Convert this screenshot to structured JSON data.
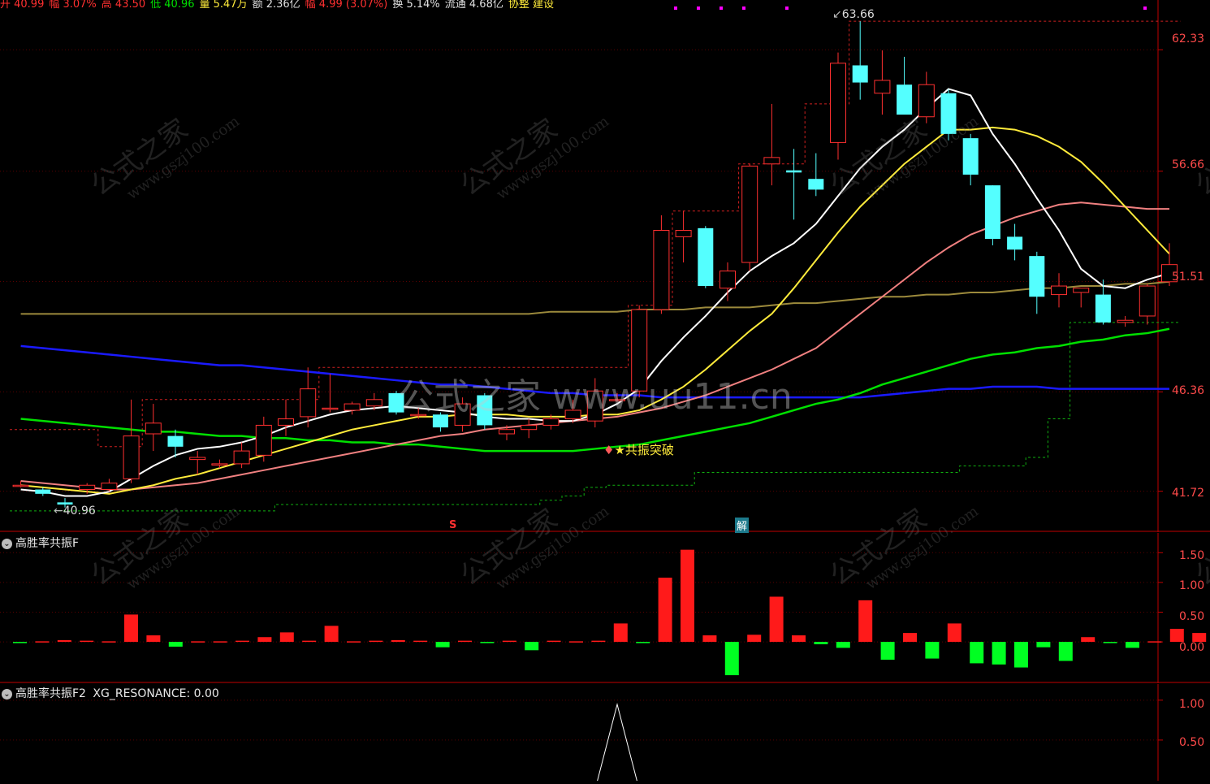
{
  "info_bar": {
    "items": [
      {
        "text": "开 40.99",
        "color": "#ff3030"
      },
      {
        "text": "幅 3.07%",
        "color": "#ff3030"
      },
      {
        "text": "高 43.50",
        "color": "#ff3030"
      },
      {
        "text": "低 40.96",
        "color": "#00e000"
      },
      {
        "text": "量 5.47万",
        "color": "#ffeb3b"
      },
      {
        "text": "额 2.36亿",
        "color": "#e0e0e0"
      },
      {
        "text": "幅 4.99 (3.07%)",
        "color": "#ff3030"
      },
      {
        "text": "换 5.14%",
        "color": "#e0e0e0"
      },
      {
        "text": "流通 4.68亿",
        "color": "#e0e0e0"
      },
      {
        "text": "协整 建设",
        "color": "#ffeb3b"
      }
    ]
  },
  "price_axis": {
    "labels": [
      "62.33",
      "56.66",
      "51.51",
      "46.36",
      "41.72"
    ]
  },
  "annotations": {
    "high_label": "63.66",
    "low_label": "40.96",
    "resonance_label": "★共振突破",
    "marker_s": "S",
    "marker_jie": "解"
  },
  "center_watermark": "公式之家  www.uu11.cn",
  "watermark_text": {
    "main": "公式之家",
    "url": "www.gszj100.com"
  },
  "osc_panel": {
    "title": "高胜率共振F",
    "axis_labels": [
      "1.50",
      "1.00",
      "0.50",
      "0.00"
    ]
  },
  "sig_panel": {
    "title": "高胜率共振F2",
    "indicator_label": "XG_RESONANCE: 0.00",
    "axis_labels": [
      "1.00",
      "0.50"
    ]
  },
  "colors": {
    "up": "#ff3030",
    "down": "#54ffff",
    "ma5": "#ffffff",
    "ma10": "#ffeb3b",
    "ma20": "#f08080",
    "ma60": "#00e000",
    "ma_long1": "#9c8a3c",
    "ma_long2": "#1a1aff",
    "axis": "#c00000"
  },
  "chart_data": {
    "type": "candlestick",
    "price_axis_range": [
      40.0,
      64.5
    ],
    "candles": [
      {
        "o": 42.0,
        "h": 42.2,
        "l": 41.9,
        "c": 42.0
      },
      {
        "o": 41.8,
        "h": 41.9,
        "l": 41.5,
        "c": 41.6
      },
      {
        "o": 41.2,
        "h": 41.4,
        "l": 40.96,
        "c": 41.1
      },
      {
        "o": 41.8,
        "h": 42.1,
        "l": 41.6,
        "c": 42.0
      },
      {
        "o": 41.8,
        "h": 42.3,
        "l": 41.7,
        "c": 42.1
      },
      {
        "o": 42.3,
        "h": 46.0,
        "l": 42.1,
        "c": 44.3
      },
      {
        "o": 44.4,
        "h": 45.8,
        "l": 43.6,
        "c": 44.9
      },
      {
        "o": 44.3,
        "h": 44.6,
        "l": 43.3,
        "c": 43.8
      },
      {
        "o": 43.2,
        "h": 43.6,
        "l": 42.5,
        "c": 43.3
      },
      {
        "o": 43.0,
        "h": 43.2,
        "l": 42.8,
        "c": 43.0
      },
      {
        "o": 43.0,
        "h": 44.0,
        "l": 42.8,
        "c": 43.6
      },
      {
        "o": 43.4,
        "h": 45.2,
        "l": 43.1,
        "c": 44.8
      },
      {
        "o": 44.8,
        "h": 46.0,
        "l": 44.3,
        "c": 45.1
      },
      {
        "o": 45.2,
        "h": 47.5,
        "l": 44.7,
        "c": 46.5
      },
      {
        "o": 45.6,
        "h": 47.2,
        "l": 45.4,
        "c": 45.6
      },
      {
        "o": 45.5,
        "h": 45.9,
        "l": 45.3,
        "c": 45.8
      },
      {
        "o": 45.7,
        "h": 46.3,
        "l": 45.5,
        "c": 46.0
      },
      {
        "o": 46.3,
        "h": 46.4,
        "l": 45.3,
        "c": 45.4
      },
      {
        "o": 45.3,
        "h": 45.6,
        "l": 45.1,
        "c": 45.3
      },
      {
        "o": 45.3,
        "h": 45.4,
        "l": 44.5,
        "c": 44.7
      },
      {
        "o": 44.8,
        "h": 46.1,
        "l": 44.5,
        "c": 45.8
      },
      {
        "o": 46.2,
        "h": 46.3,
        "l": 44.6,
        "c": 44.8
      },
      {
        "o": 44.4,
        "h": 44.8,
        "l": 44.1,
        "c": 44.6
      },
      {
        "o": 44.6,
        "h": 45.1,
        "l": 44.2,
        "c": 44.8
      },
      {
        "o": 44.8,
        "h": 45.3,
        "l": 44.6,
        "c": 45.1
      },
      {
        "o": 45.1,
        "h": 46.0,
        "l": 44.9,
        "c": 45.5
      },
      {
        "o": 45.0,
        "h": 47.0,
        "l": 44.7,
        "c": 46.4
      },
      {
        "o": 46.0,
        "h": 46.3,
        "l": 45.9,
        "c": 46.0
      },
      {
        "o": 46.4,
        "h": 50.4,
        "l": 46.1,
        "c": 50.2
      },
      {
        "o": 50.2,
        "h": 54.6,
        "l": 50.0,
        "c": 53.9
      },
      {
        "o": 53.6,
        "h": 54.8,
        "l": 52.4,
        "c": 53.9
      },
      {
        "o": 54.0,
        "h": 54.1,
        "l": 51.2,
        "c": 51.3
      },
      {
        "o": 51.2,
        "h": 52.4,
        "l": 50.6,
        "c": 52.0
      },
      {
        "o": 52.4,
        "h": 57.0,
        "l": 52.0,
        "c": 56.9
      },
      {
        "o": 57.0,
        "h": 59.8,
        "l": 56.0,
        "c": 57.3
      },
      {
        "o": 56.7,
        "h": 57.7,
        "l": 54.4,
        "c": 56.6
      },
      {
        "o": 56.3,
        "h": 57.5,
        "l": 55.5,
        "c": 55.8
      },
      {
        "o": 58.0,
        "h": 62.2,
        "l": 57.2,
        "c": 61.7
      },
      {
        "o": 61.6,
        "h": 63.66,
        "l": 60.0,
        "c": 60.8
      },
      {
        "o": 60.3,
        "h": 62.3,
        "l": 59.3,
        "c": 60.9
      },
      {
        "o": 60.7,
        "h": 62.0,
        "l": 59.4,
        "c": 59.3
      },
      {
        "o": 59.2,
        "h": 61.3,
        "l": 58.9,
        "c": 60.7
      },
      {
        "o": 60.3,
        "h": 60.5,
        "l": 58.1,
        "c": 58.4
      },
      {
        "o": 58.2,
        "h": 58.4,
        "l": 56.0,
        "c": 56.5
      },
      {
        "o": 56.0,
        "h": 56.0,
        "l": 53.2,
        "c": 53.5
      },
      {
        "o": 53.6,
        "h": 54.2,
        "l": 52.5,
        "c": 53.0
      },
      {
        "o": 52.7,
        "h": 52.9,
        "l": 50.0,
        "c": 50.8
      },
      {
        "o": 50.9,
        "h": 51.9,
        "l": 50.3,
        "c": 51.3
      },
      {
        "o": 51.0,
        "h": 51.2,
        "l": 50.3,
        "c": 51.2
      },
      {
        "o": 50.9,
        "h": 51.6,
        "l": 49.5,
        "c": 49.6
      },
      {
        "o": 49.6,
        "h": 49.9,
        "l": 49.4,
        "c": 49.7
      },
      {
        "o": 49.9,
        "h": 51.4,
        "l": 49.5,
        "c": 51.3
      },
      {
        "o": 51.5,
        "h": 53.3,
        "l": 51.3,
        "c": 52.3
      }
    ],
    "ma5": [
      41.8,
      41.7,
      41.5,
      41.5,
      41.7,
      42.3,
      42.9,
      43.4,
      43.7,
      43.8,
      44.0,
      44.3,
      44.7,
      45.0,
      45.3,
      45.5,
      45.6,
      45.7,
      45.6,
      45.5,
      45.4,
      45.2,
      45.1,
      45.1,
      45.0,
      45.0,
      45.3,
      45.8,
      46.5,
      47.8,
      48.9,
      49.9,
      51.0,
      52.0,
      52.7,
      53.3,
      54.2,
      55.5,
      56.8,
      57.8,
      58.6,
      59.6,
      60.5,
      60.2,
      58.4,
      57.0,
      55.4,
      53.9,
      52.1,
      51.3,
      51.2,
      51.6,
      51.9
    ],
    "ma10": [
      42.0,
      41.9,
      41.8,
      41.7,
      41.6,
      41.8,
      42.0,
      42.3,
      42.5,
      42.8,
      43.1,
      43.4,
      43.7,
      44.0,
      44.3,
      44.6,
      44.8,
      45.0,
      45.2,
      45.2,
      45.3,
      45.3,
      45.3,
      45.2,
      45.2,
      45.2,
      45.3,
      45.3,
      45.5,
      46.0,
      46.6,
      47.4,
      48.3,
      49.2,
      50.0,
      51.2,
      52.5,
      53.8,
      55.0,
      56.0,
      57.0,
      57.8,
      58.6,
      58.6,
      58.7,
      58.6,
      58.3,
      57.8,
      57.1,
      56.1,
      55.0,
      53.9,
      52.8
    ],
    "ma20": [
      42.2,
      42.1,
      42.0,
      41.9,
      41.8,
      41.8,
      41.9,
      42.0,
      42.1,
      42.3,
      42.5,
      42.7,
      42.9,
      43.1,
      43.3,
      43.5,
      43.7,
      43.9,
      44.1,
      44.3,
      44.4,
      44.6,
      44.7,
      44.8,
      44.9,
      45.0,
      45.1,
      45.2,
      45.4,
      45.6,
      45.9,
      46.2,
      46.6,
      47.0,
      47.4,
      47.9,
      48.4,
      49.2,
      50.0,
      50.8,
      51.6,
      52.4,
      53.1,
      53.7,
      54.1,
      54.5,
      54.8,
      55.1,
      55.2,
      55.1,
      55.0,
      54.9,
      54.9
    ],
    "ma60": [
      45.1,
      45.0,
      44.9,
      44.8,
      44.7,
      44.6,
      44.5,
      44.5,
      44.4,
      44.3,
      44.3,
      44.2,
      44.2,
      44.1,
      44.1,
      44.0,
      44.0,
      43.9,
      43.9,
      43.8,
      43.7,
      43.6,
      43.6,
      43.6,
      43.6,
      43.6,
      43.7,
      43.8,
      43.9,
      44.1,
      44.3,
      44.5,
      44.7,
      44.9,
      45.2,
      45.5,
      45.8,
      46.0,
      46.3,
      46.7,
      47.0,
      47.3,
      47.6,
      47.9,
      48.1,
      48.2,
      48.4,
      48.5,
      48.7,
      48.8,
      49.0,
      49.1,
      49.3
    ],
    "ma_long1": [
      50.0,
      50.0,
      50.0,
      50.0,
      50.0,
      50.0,
      50.0,
      50.0,
      50.0,
      50.0,
      50.0,
      50.0,
      50.0,
      50.0,
      50.0,
      50.0,
      50.0,
      50.0,
      50.0,
      50.0,
      50.0,
      50.0,
      50.0,
      50.0,
      50.1,
      50.1,
      50.1,
      50.1,
      50.2,
      50.2,
      50.2,
      50.3,
      50.3,
      50.3,
      50.4,
      50.5,
      50.5,
      50.6,
      50.7,
      50.8,
      50.8,
      50.9,
      50.9,
      51.0,
      51.0,
      51.1,
      51.2,
      51.2,
      51.3,
      51.3,
      51.4,
      51.4,
      51.5
    ],
    "ma_long2": [
      48.5,
      48.4,
      48.3,
      48.2,
      48.1,
      48.0,
      47.9,
      47.8,
      47.7,
      47.6,
      47.6,
      47.5,
      47.4,
      47.3,
      47.2,
      47.1,
      47.0,
      46.9,
      46.8,
      46.7,
      46.7,
      46.6,
      46.5,
      46.4,
      46.3,
      46.3,
      46.2,
      46.2,
      46.2,
      46.1,
      46.1,
      46.1,
      46.1,
      46.1,
      46.1,
      46.1,
      46.1,
      46.1,
      46.1,
      46.2,
      46.3,
      46.4,
      46.5,
      46.5,
      46.6,
      46.6,
      46.6,
      46.5,
      46.5,
      46.5,
      46.5,
      46.5,
      46.5
    ],
    "upper_band": [
      44.6,
      44.6,
      44.6,
      44.6,
      43.8,
      43.8,
      46.0,
      46.0,
      46.0,
      46.0,
      46.0,
      46.0,
      46.0,
      46.0,
      47.5,
      47.5,
      47.5,
      47.5,
      47.5,
      47.5,
      47.5,
      47.5,
      47.5,
      47.5,
      47.5,
      47.5,
      47.5,
      47.5,
      50.4,
      50.4,
      54.8,
      54.8,
      54.8,
      57.0,
      57.0,
      57.0,
      59.8,
      59.8,
      63.66,
      63.66,
      63.66,
      63.66,
      63.66,
      63.66,
      63.66,
      63.66,
      63.66,
      63.66,
      63.66,
      63.66,
      63.66,
      63.66,
      63.66
    ],
    "lower_band": [
      40.8,
      40.8,
      40.8,
      40.8,
      40.8,
      40.8,
      40.8,
      40.8,
      40.8,
      40.8,
      40.8,
      40.8,
      41.1,
      41.1,
      41.1,
      41.1,
      41.1,
      41.1,
      41.1,
      41.1,
      41.1,
      41.1,
      41.1,
      41.1,
      41.3,
      41.5,
      41.9,
      42.0,
      42.0,
      42.0,
      42.0,
      42.6,
      42.6,
      42.6,
      42.6,
      42.6,
      42.6,
      42.6,
      42.6,
      42.6,
      42.6,
      42.6,
      42.6,
      42.9,
      42.9,
      42.9,
      43.3,
      45.1,
      49.6,
      49.6,
      49.6,
      49.6,
      49.6
    ],
    "osc_values": [
      -0.02,
      0.01,
      0.03,
      0.02,
      0.01,
      0.46,
      0.11,
      -0.08,
      0.01,
      0.01,
      0.02,
      0.08,
      0.16,
      0.02,
      0.27,
      0.01,
      0.02,
      0.03,
      0.02,
      -0.09,
      0.02,
      -0.01,
      0.02,
      -0.14,
      0.02,
      0.01,
      0.02,
      0.31,
      -0.02,
      1.08,
      1.55,
      0.11,
      -0.56,
      0.12,
      0.76,
      0.11,
      -0.04,
      -0.1,
      0.7,
      -0.3,
      0.15,
      -0.28,
      0.31,
      -0.36,
      -0.38,
      -0.43,
      -0.09,
      -0.32,
      0.08,
      -0.02,
      -0.1,
      0.01,
      0.22,
      0.15
    ],
    "signal_values": [
      0,
      0,
      0,
      0,
      0,
      0,
      0,
      0,
      0,
      0,
      0,
      0,
      0,
      0,
      0,
      0,
      0,
      0,
      0,
      0,
      0,
      0,
      0,
      0,
      0,
      0,
      0,
      1,
      0,
      0,
      0,
      0,
      0,
      0,
      0,
      0,
      0,
      0,
      0,
      0,
      0,
      0,
      0,
      0,
      0,
      0,
      0,
      0,
      0,
      0,
      0,
      0,
      0
    ],
    "osc_axis_range": [
      -0.6,
      1.75
    ],
    "signal_axis_range": [
      0,
      1.1
    ]
  }
}
